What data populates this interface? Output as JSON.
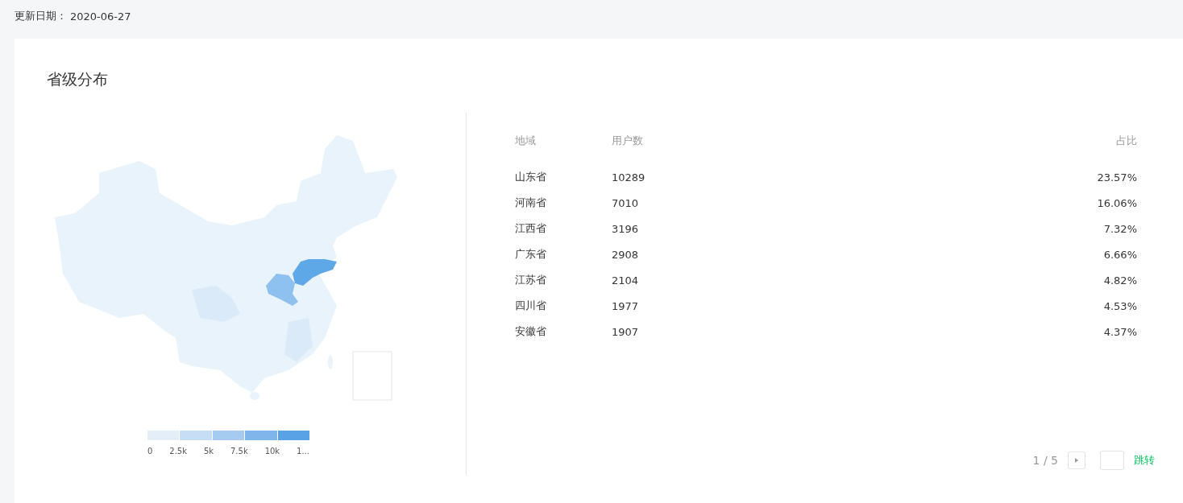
{
  "update": {
    "label": "更新日期：",
    "date": "2020-06-27"
  },
  "card": {
    "title": "省级分布",
    "legend": {
      "labels": [
        "0",
        "2.5k",
        "5k",
        "7.5k",
        "10k",
        "1..."
      ]
    },
    "table": {
      "columns": [
        "地域",
        "用户数",
        "占比"
      ],
      "rows": [
        {
          "region": "山东省",
          "users": "10289",
          "share": "23.57%"
        },
        {
          "region": "河南省",
          "users": "7010",
          "share": "16.06%"
        },
        {
          "region": "江西省",
          "users": "3196",
          "share": "7.32%"
        },
        {
          "region": "广东省",
          "users": "2908",
          "share": "6.66%"
        },
        {
          "region": "江苏省",
          "users": "2104",
          "share": "4.82%"
        },
        {
          "region": "四川省",
          "users": "1977",
          "share": "4.53%"
        },
        {
          "region": "安徽省",
          "users": "1907",
          "share": "4.37%"
        }
      ]
    },
    "pagination": {
      "page": "1 / 5",
      "jump": "跳转"
    }
  }
}
